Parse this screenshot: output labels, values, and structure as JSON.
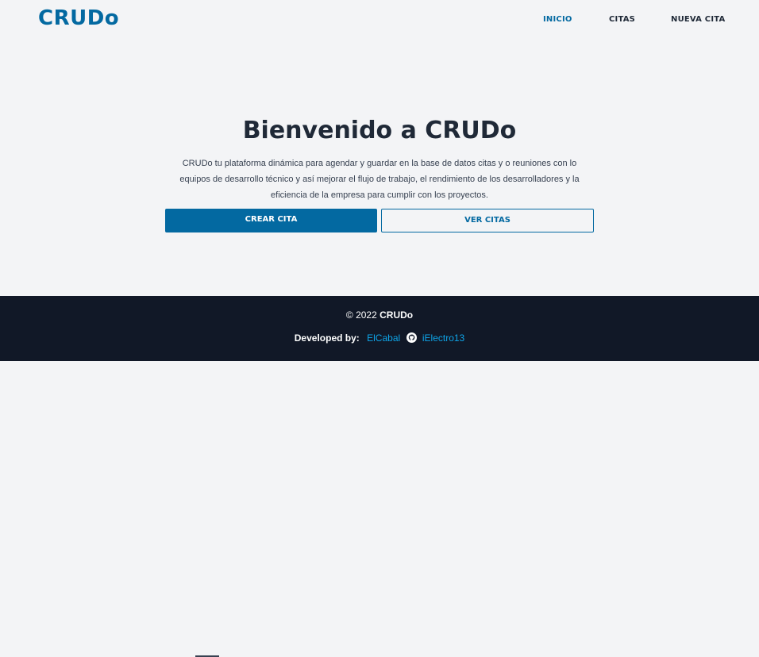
{
  "header": {
    "brand": "CRUDo",
    "nav": [
      {
        "label": "INICIO",
        "active": true
      },
      {
        "label": "CITAS",
        "active": false
      },
      {
        "label": "NUEVA CITA",
        "active": false
      }
    ]
  },
  "hero": {
    "title": "Bienvenido a CRUDo",
    "description": "CRUDo tu plataforma dinámica para agendar y guardar en la base de datos citas y o reuniones con lo equipos de desarrollo técnico y así mejorar el flujo de trabajo, el rendimiento de los desarrolladores y la eficiencia de la empresa para cumplir con los proyectos.",
    "primary_button": "CREAR CITA",
    "secondary_button": "VER CITAS"
  },
  "footer": {
    "copyright_prefix": "© 2022",
    "copyright_name": "CRUDo",
    "developed_by": "Developed by:",
    "dev1": "ElCabal",
    "github_icon": "github-icon",
    "dev2": "iElectro13"
  },
  "colors": {
    "accent": "#0369a1",
    "background": "#f3f4f6",
    "footer": "#111827",
    "text": "#1f2937",
    "link": "#0ea5e9"
  }
}
